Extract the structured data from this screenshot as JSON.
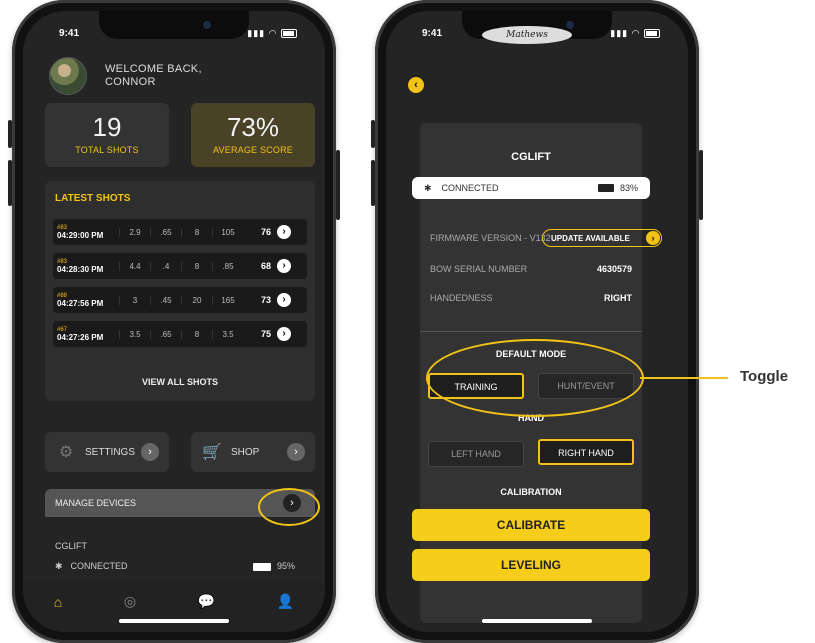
{
  "left_phone": {
    "status_time": "9:41",
    "welcome_line1": "WELCOME BACK,",
    "welcome_line2": "CONNOR",
    "stats": [
      {
        "value": "19",
        "label": "TOTAL SHOTS"
      },
      {
        "value": "73%",
        "label": "AVERAGE SCORE"
      }
    ],
    "latest_title": "LATEST SHOTS",
    "shots": [
      {
        "num": "#83",
        "time": "04:29:00 PM",
        "c1": "2.9",
        "c2": ".65",
        "c3": "8",
        "c4": "105",
        "score": "76"
      },
      {
        "num": "#83",
        "time": "04:28:30 PM",
        "c1": "4.4",
        "c2": ".4",
        "c3": "8",
        "c4": ".85",
        "score": "68"
      },
      {
        "num": "#88",
        "time": "04:27:56 PM",
        "c1": "3",
        "c2": ".45",
        "c3": "20",
        "c4": "165",
        "score": "73"
      },
      {
        "num": "#67",
        "time": "04:27:26 PM",
        "c1": "3.5",
        "c2": ".65",
        "c3": "8",
        "c4": "3.5",
        "score": "75"
      }
    ],
    "view_all": "VIEW ALL SHOTS",
    "settings_label": "SETTINGS",
    "shop_label": "SHOP",
    "manage_label": "MANAGE DEVICES",
    "device_name": "CGLIFT",
    "device_status": "CONNECTED",
    "device_battery": "95%"
  },
  "right_phone": {
    "status_time": "9:41",
    "logo_text": "Mathews",
    "title": "CGLIFT",
    "connected": "CONNECTED",
    "battery": "83%",
    "firmware_label": "FIRMWARE VERSION - V132",
    "update_label": "UPDATE AVAILABLE",
    "serial_label": "BOW SERIAL NUMBER",
    "serial_value": "4630579",
    "handedness_label": "HANDEDNESS",
    "handedness_value": "RIGHT",
    "default_mode_title": "DEFAULT MODE",
    "mode_training": "TRAINING",
    "mode_hunt": "HUNT/EVENT",
    "hand_title": "HAND",
    "left_hand": "LEFT HAND",
    "right_hand": "RIGHT HAND",
    "calibration_title": "CALIBRATION",
    "calibrate_btn": "CALIBRATE",
    "leveling_btn": "LEVELING"
  },
  "annotation": {
    "toggle_label": "Toggle",
    "accent_color": "#f2c316"
  }
}
